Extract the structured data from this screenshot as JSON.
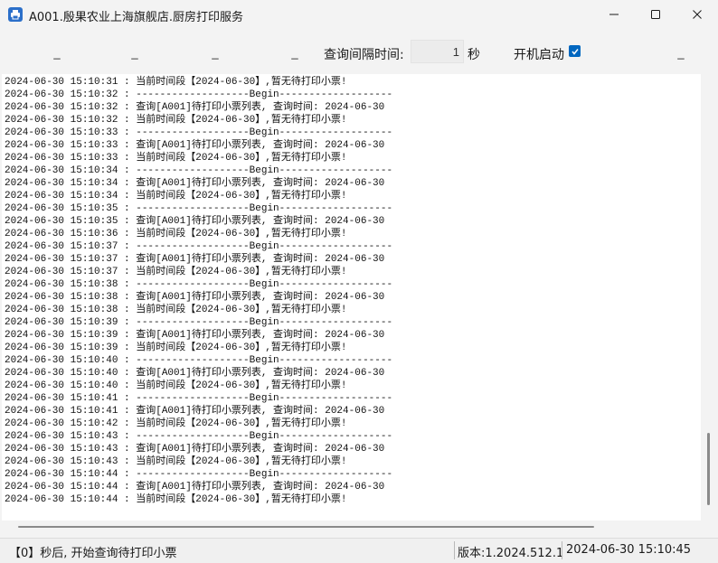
{
  "window": {
    "title": "A001.殷果农业上海旗舰店.厨房打印服务",
    "minimize_icon": "minimize-icon",
    "maximize_icon": "maximize-icon",
    "close_icon": "close-icon"
  },
  "toolbar": {
    "btn1_label": "_",
    "btn2_label": "_",
    "btn3_label": "_",
    "btn4_label": "_",
    "btn5_label": "_",
    "interval_label": "查询间隔时间:",
    "interval_value": "1",
    "interval_unit": "秒",
    "autostart_label": "开机启动",
    "autostart_checked": true
  },
  "log": {
    "lines": [
      "2024-06-30 15:10:31 : 当前时间段【2024-06-30】,暂无待打印小票!",
      "2024-06-30 15:10:32 : -------------------Begin-------------------",
      "2024-06-30 15:10:32 : 查询[A001]待打印小票列表, 查询时间: 2024-06-30",
      "2024-06-30 15:10:32 : 当前时间段【2024-06-30】,暂无待打印小票!",
      "2024-06-30 15:10:33 : -------------------Begin-------------------",
      "2024-06-30 15:10:33 : 查询[A001]待打印小票列表, 查询时间: 2024-06-30",
      "2024-06-30 15:10:33 : 当前时间段【2024-06-30】,暂无待打印小票!",
      "2024-06-30 15:10:34 : -------------------Begin-------------------",
      "2024-06-30 15:10:34 : 查询[A001]待打印小票列表, 查询时间: 2024-06-30",
      "2024-06-30 15:10:34 : 当前时间段【2024-06-30】,暂无待打印小票!",
      "2024-06-30 15:10:35 : -------------------Begin-------------------",
      "2024-06-30 15:10:35 : 查询[A001]待打印小票列表, 查询时间: 2024-06-30",
      "2024-06-30 15:10:36 : 当前时间段【2024-06-30】,暂无待打印小票!",
      "2024-06-30 15:10:37 : -------------------Begin-------------------",
      "2024-06-30 15:10:37 : 查询[A001]待打印小票列表, 查询时间: 2024-06-30",
      "2024-06-30 15:10:37 : 当前时间段【2024-06-30】,暂无待打印小票!",
      "2024-06-30 15:10:38 : -------------------Begin-------------------",
      "2024-06-30 15:10:38 : 查询[A001]待打印小票列表, 查询时间: 2024-06-30",
      "2024-06-30 15:10:38 : 当前时间段【2024-06-30】,暂无待打印小票!",
      "2024-06-30 15:10:39 : -------------------Begin-------------------",
      "2024-06-30 15:10:39 : 查询[A001]待打印小票列表, 查询时间: 2024-06-30",
      "2024-06-30 15:10:39 : 当前时间段【2024-06-30】,暂无待打印小票!",
      "2024-06-30 15:10:40 : -------------------Begin-------------------",
      "2024-06-30 15:10:40 : 查询[A001]待打印小票列表, 查询时间: 2024-06-30",
      "2024-06-30 15:10:40 : 当前时间段【2024-06-30】,暂无待打印小票!",
      "2024-06-30 15:10:41 : -------------------Begin-------------------",
      "2024-06-30 15:10:41 : 查询[A001]待打印小票列表, 查询时间: 2024-06-30",
      "2024-06-30 15:10:42 : 当前时间段【2024-06-30】,暂无待打印小票!",
      "2024-06-30 15:10:43 : -------------------Begin-------------------",
      "2024-06-30 15:10:43 : 查询[A001]待打印小票列表, 查询时间: 2024-06-30",
      "2024-06-30 15:10:43 : 当前时间段【2024-06-30】,暂无待打印小票!",
      "2024-06-30 15:10:44 : -------------------Begin-------------------",
      "2024-06-30 15:10:44 : 查询[A001]待打印小票列表, 查询时间: 2024-06-30",
      "2024-06-30 15:10:44 : 当前时间段【2024-06-30】,暂无待打印小票!"
    ]
  },
  "status": {
    "message": "【0】秒后, 开始查询待打印小票",
    "version": "版本:1.2024.512.1",
    "datetime": "2024-06-30 15:10:45"
  },
  "colors": {
    "checkbox_accent": "#0067c0",
    "app_icon": "#2b6fc9"
  }
}
